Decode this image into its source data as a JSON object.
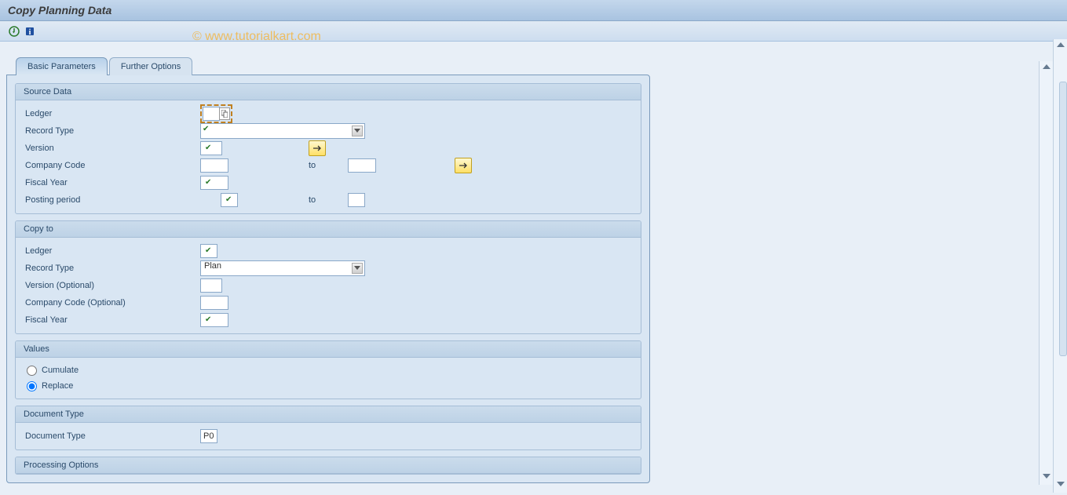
{
  "title": "Copy Planning Data",
  "watermark": "© www.tutorialkart.com",
  "tabs": [
    {
      "label": "Basic Parameters"
    },
    {
      "label": "Further Options"
    }
  ],
  "sourceData": {
    "title": "Source Data",
    "ledger_label": "Ledger",
    "ledger_value": "",
    "record_type_label": "Record Type",
    "record_type_value": "",
    "version_label": "Version",
    "version_value": "",
    "company_code_label": "Company Code",
    "company_code_from": "",
    "company_code_to_label": "to",
    "company_code_to": "",
    "fiscal_year_label": "Fiscal Year",
    "fiscal_year_value": "",
    "posting_period_label": "Posting period",
    "posting_period_from": "",
    "posting_period_to_label": "to",
    "posting_period_to": ""
  },
  "copyTo": {
    "title": "Copy to",
    "ledger_label": "Ledger",
    "ledger_value": "",
    "record_type_label": "Record Type",
    "record_type_value": "Plan",
    "version_label": "Version (Optional)",
    "version_value": "",
    "company_code_label": "Company Code (Optional)",
    "company_code_value": "",
    "fiscal_year_label": "Fiscal Year",
    "fiscal_year_value": ""
  },
  "values": {
    "title": "Values",
    "cumulate_label": "Cumulate",
    "replace_label": "Replace"
  },
  "documentType": {
    "title": "Document Type",
    "label": "Document Type",
    "value": "P0"
  },
  "processingOptions": {
    "title": "Processing Options"
  }
}
